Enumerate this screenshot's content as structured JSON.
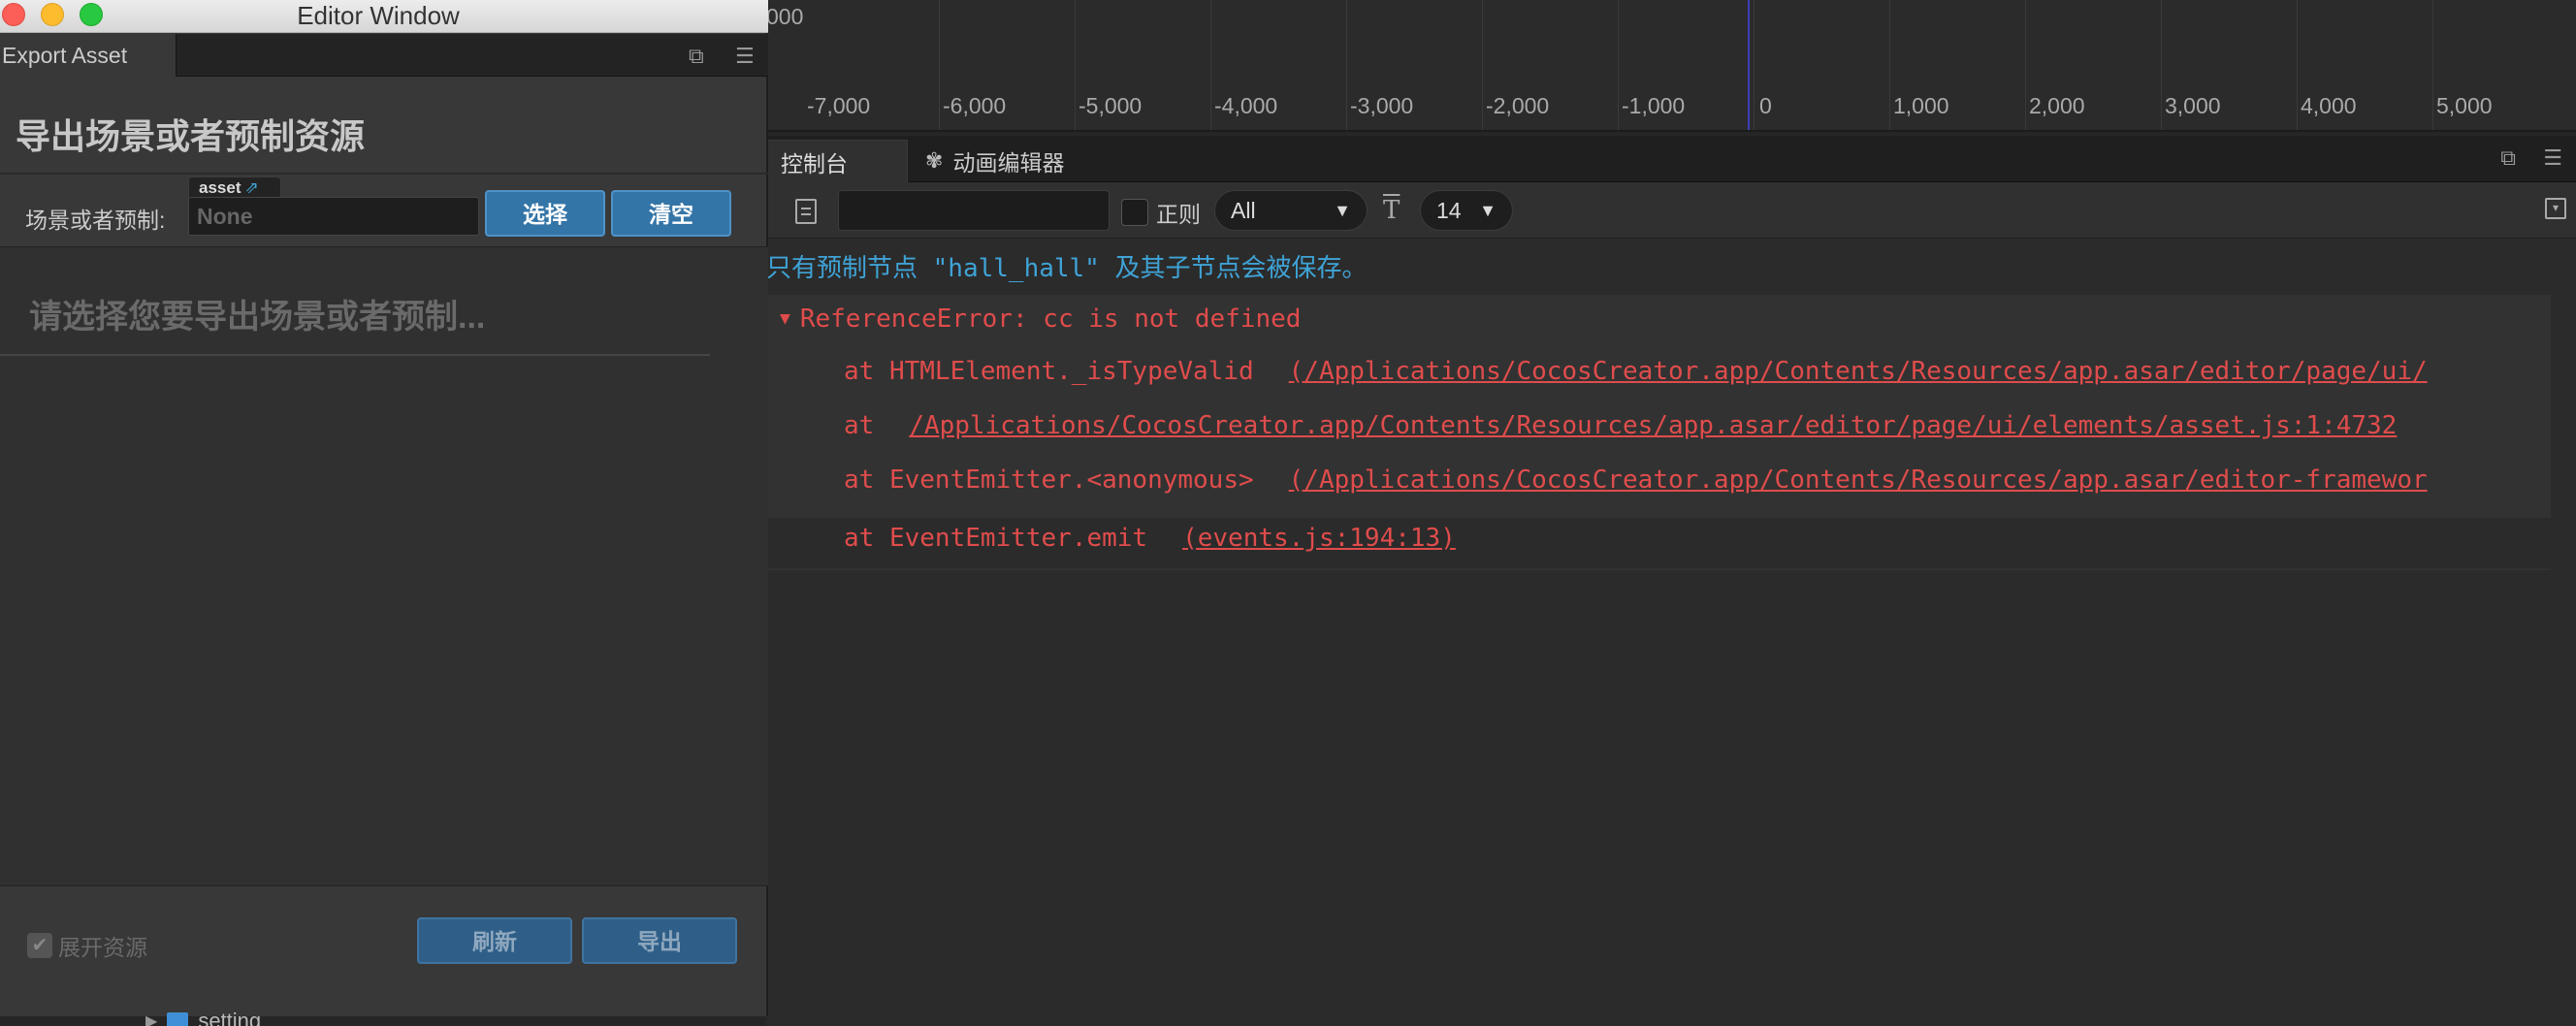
{
  "window": {
    "title": "Editor Window",
    "panel_tab": "Export Asset",
    "heading": "导出场景或者预制资源",
    "prop_label": "场景或者预制:",
    "asset_tag": "asset",
    "asset_value": "None",
    "select_button": "选择",
    "clear_button": "清空",
    "placeholder": "请选择您要导出场景或者预制...",
    "expand_assets_label": "展开资源",
    "refresh_button": "刷新",
    "export_button": "导出",
    "tree_fragment": "setting"
  },
  "ruler": {
    "top_fragment": "000",
    "ticks": [
      "-7,000",
      "-6,000",
      "-5,000",
      "-4,000",
      "-3,000",
      "-2,000",
      "-1,000",
      "0",
      "1,000",
      "2,000",
      "3,000",
      "4,000",
      "5,000"
    ]
  },
  "dock": {
    "tabs": [
      {
        "label": "控制台"
      },
      {
        "label": "动画编辑器"
      }
    ]
  },
  "console": {
    "regex_label": "正则",
    "level_select": "All",
    "font_size_select": "14",
    "info_line": "只有预制节点 \"hall_hall\" 及其子节点会被保存。",
    "error_title": "ReferenceError: cc is not defined",
    "stack": [
      {
        "prefix": "at HTMLElement._isTypeValid",
        "link": "(/Applications/CocosCreator.app/Contents/Resources/app.asar/editor/page/ui/"
      },
      {
        "prefix": "at",
        "link": "/Applications/CocosCreator.app/Contents/Resources/app.asar/editor/page/ui/elements/asset.js:1:4732"
      },
      {
        "prefix": "at EventEmitter.<anonymous>",
        "link": "(/Applications/CocosCreator.app/Contents/Resources/app.asar/editor-framewor"
      },
      {
        "prefix": "at EventEmitter.emit",
        "link": "(events.js:194:13)"
      }
    ]
  },
  "colors": {
    "info": "#3fa3d6",
    "error": "#e04c4c",
    "accent_button": "#3475a8"
  },
  "icons": [
    "close-traffic-icon",
    "minimize-traffic-icon",
    "zoom-traffic-icon",
    "popout-icon",
    "menu-icon",
    "document-icon",
    "font-size-icon",
    "animation-icon",
    "collapse-icon",
    "external-link-icon",
    "folder-icon",
    "caret-right-icon"
  ]
}
